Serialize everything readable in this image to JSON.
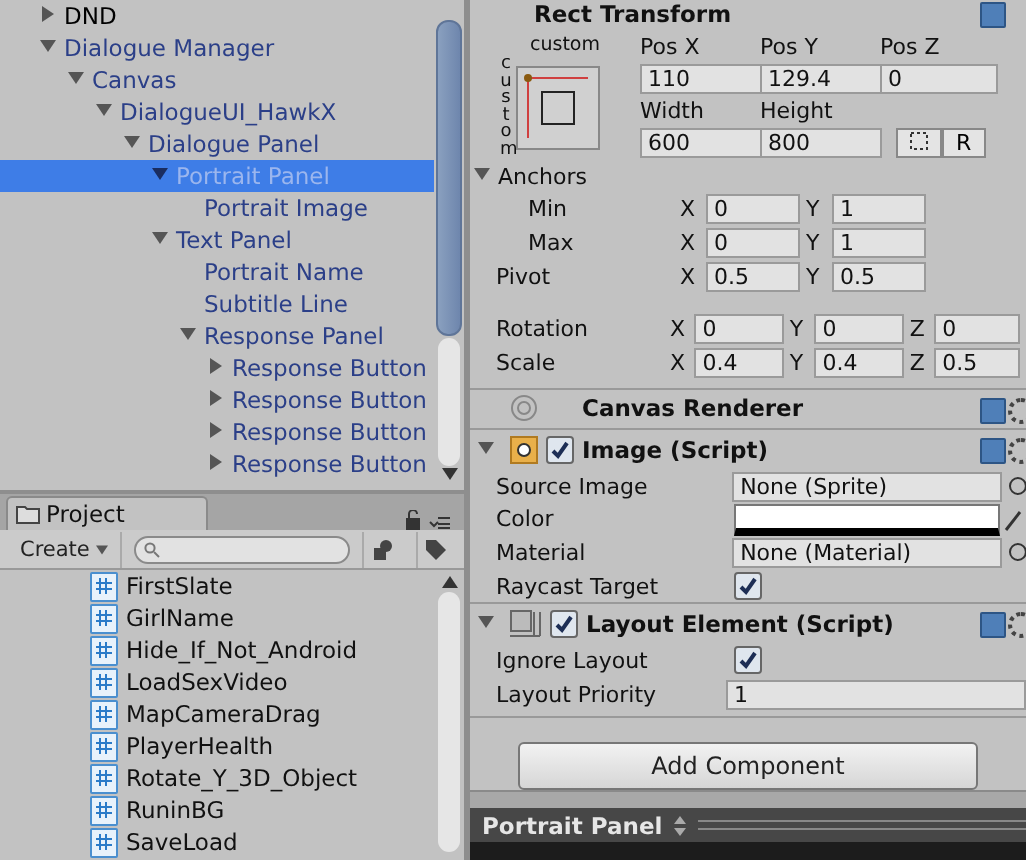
{
  "hierarchy": {
    "items": [
      {
        "label": "DND",
        "kind": "group",
        "expanded": false,
        "prefab": false,
        "selected": false
      },
      {
        "label": "Dialogue Manager",
        "kind": "group",
        "expanded": true,
        "prefab": true,
        "selected": false,
        "children": [
          {
            "label": "Canvas",
            "kind": "group",
            "expanded": true,
            "prefab": true,
            "selected": false,
            "children": [
              {
                "label": "DialogueUI_HawkX",
                "kind": "group",
                "expanded": true,
                "prefab": true,
                "selected": false,
                "children": [
                  {
                    "label": "Dialogue Panel",
                    "kind": "group",
                    "expanded": true,
                    "prefab": true,
                    "selected": false,
                    "children": [
                      {
                        "label": "Portrait Panel",
                        "kind": "group",
                        "expanded": true,
                        "prefab": true,
                        "selected": true,
                        "children": [
                          {
                            "label": "Portrait Image",
                            "kind": "leaf",
                            "expanded": false,
                            "prefab": true,
                            "selected": false
                          }
                        ]
                      },
                      {
                        "label": "Text Panel",
                        "kind": "group",
                        "expanded": true,
                        "prefab": true,
                        "selected": false,
                        "children": [
                          {
                            "label": "Portrait Name",
                            "kind": "leaf",
                            "expanded": false,
                            "prefab": true,
                            "selected": false
                          },
                          {
                            "label": "Subtitle Line",
                            "kind": "leaf",
                            "expanded": false,
                            "prefab": true,
                            "selected": false
                          },
                          {
                            "label": "Response Panel",
                            "kind": "group",
                            "expanded": true,
                            "prefab": true,
                            "selected": false,
                            "children": [
                              {
                                "label": "Response Button",
                                "kind": "group",
                                "expanded": false,
                                "prefab": true,
                                "selected": false
                              },
                              {
                                "label": "Response Button",
                                "kind": "group",
                                "expanded": false,
                                "prefab": true,
                                "selected": false
                              },
                              {
                                "label": "Response Button",
                                "kind": "group",
                                "expanded": false,
                                "prefab": true,
                                "selected": false
                              },
                              {
                                "label": "Response Button",
                                "kind": "group",
                                "expanded": false,
                                "prefab": true,
                                "selected": false
                              }
                            ]
                          }
                        ]
                      }
                    ]
                  }
                ]
              }
            ]
          }
        ]
      }
    ]
  },
  "project": {
    "tab": "Project",
    "create": "Create",
    "files": [
      "FirstSlate",
      "GirlName",
      "Hide_If_Not_Android",
      "LoadSexVideo",
      "MapCameraDrag",
      "PlayerHealth",
      "Rotate_Y_3D_Object",
      "RuninBG",
      "SaveLoad"
    ]
  },
  "inspector": {
    "rect_transform": {
      "title": "Rect Transform",
      "preset_top": "custom",
      "preset_side": "custom",
      "position": [
        {
          "label": "Pos X",
          "value": "110"
        },
        {
          "label": "Pos Y",
          "value": "129.4"
        },
        {
          "label": "Pos Z",
          "value": "0"
        }
      ],
      "size": [
        {
          "label": "Width",
          "value": "600"
        },
        {
          "label": "Height",
          "value": "800"
        }
      ],
      "raw_button": "R",
      "anchors": {
        "label": "Anchors",
        "expanded": true,
        "rows": [
          {
            "label": "Min",
            "values": [
              {
                "axis": "X",
                "value": "0"
              },
              {
                "axis": "Y",
                "value": "1"
              }
            ]
          },
          {
            "label": "Max",
            "values": [
              {
                "axis": "X",
                "value": "0"
              },
              {
                "axis": "Y",
                "value": "1"
              }
            ]
          }
        ]
      },
      "rows": [
        {
          "label": "Pivot",
          "values": [
            {
              "axis": "X",
              "value": "0.5"
            },
            {
              "axis": "Y",
              "value": "0.5"
            }
          ]
        },
        {
          "label": "Rotation",
          "values": [
            {
              "axis": "X",
              "value": "0"
            },
            {
              "axis": "Y",
              "value": "0"
            },
            {
              "axis": "Z",
              "value": "0"
            }
          ]
        },
        {
          "label": "Scale",
          "values": [
            {
              "axis": "X",
              "value": "0.4"
            },
            {
              "axis": "Y",
              "value": "0.4"
            },
            {
              "axis": "Z",
              "value": "0.5"
            }
          ]
        }
      ]
    },
    "components": [
      {
        "kind": "canvas_renderer",
        "title": "Canvas Renderer"
      },
      {
        "kind": "image",
        "title": "Image (Script)",
        "enabled": true,
        "expanded": true,
        "properties": [
          {
            "kind": "object",
            "label": "Source Image",
            "value": "None (Sprite)"
          },
          {
            "kind": "color",
            "label": "Color",
            "color": "#ffffff"
          },
          {
            "kind": "object",
            "label": "Material",
            "value": "None (Material)"
          },
          {
            "kind": "checkbox",
            "label": "Raycast Target",
            "checked": true
          }
        ]
      },
      {
        "kind": "layout_element",
        "title": "Layout Element (Script)",
        "enabled": true,
        "expanded": true,
        "properties": [
          {
            "kind": "checkbox",
            "label": "Ignore Layout",
            "checked": true
          },
          {
            "kind": "text",
            "label": "Layout Priority",
            "value": "1"
          }
        ]
      }
    ],
    "add_component": "Add Component"
  },
  "bottom_bar": {
    "tab": "Portrait Panel"
  }
}
